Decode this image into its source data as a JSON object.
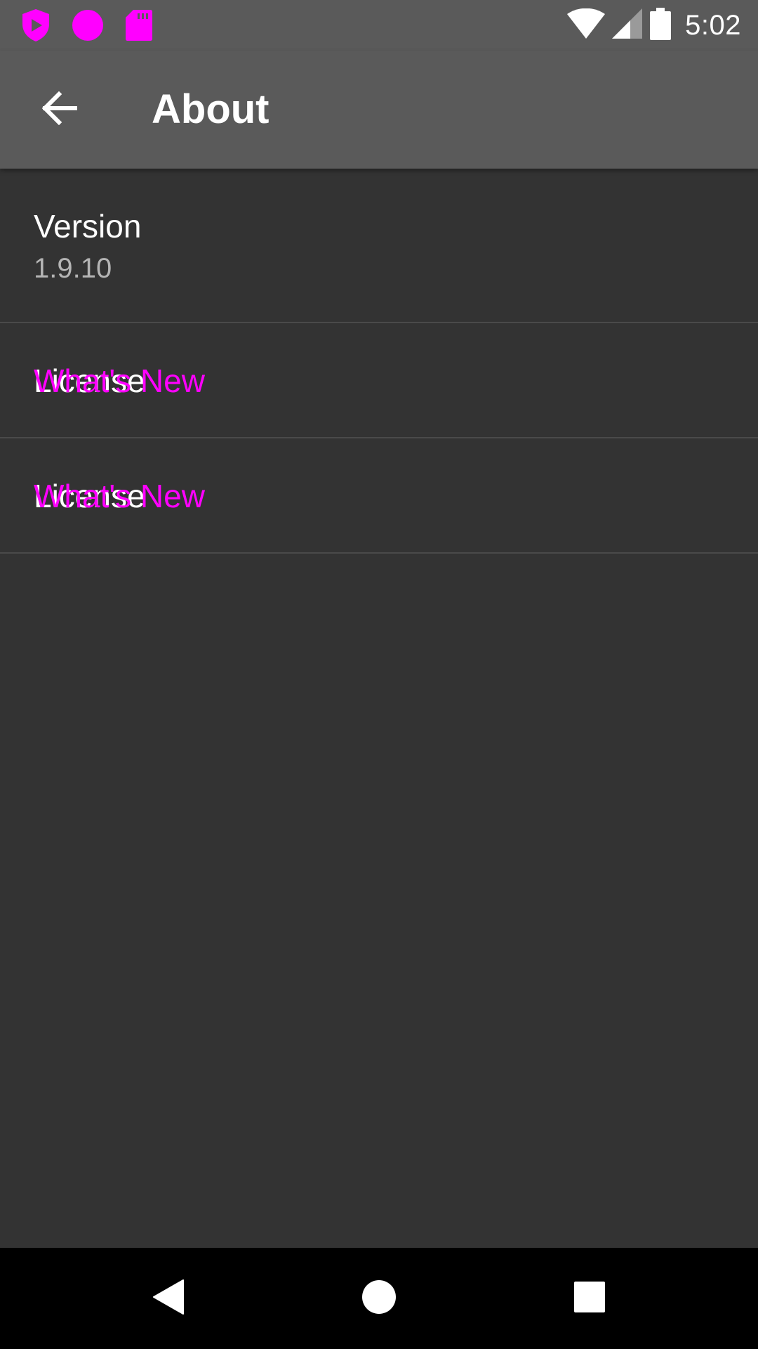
{
  "status_bar": {
    "time": "5:02",
    "left_icons": [
      "shield-play-icon",
      "circle-icon",
      "sd-card-icon"
    ],
    "right_icons": [
      "wifi-icon",
      "cell-signal-icon",
      "battery-icon"
    ],
    "notification_icon_color": "#ff00ff"
  },
  "toolbar": {
    "title": "About",
    "back_icon": "arrow-back-icon"
  },
  "list": {
    "version": {
      "title": "Version",
      "value": "1.9.10"
    },
    "items": [
      {
        "label_white": "License",
        "label_magenta": "What's New"
      },
      {
        "label_white": "License",
        "label_magenta": "What's New"
      }
    ]
  },
  "nav_bar": {
    "buttons": [
      "back-triangle-icon",
      "home-circle-icon",
      "recents-square-icon"
    ]
  },
  "colors": {
    "background": "#333333",
    "toolbar": "#5a5a5a",
    "accent": "#ff00ff",
    "divider": "#4a4a4a"
  }
}
